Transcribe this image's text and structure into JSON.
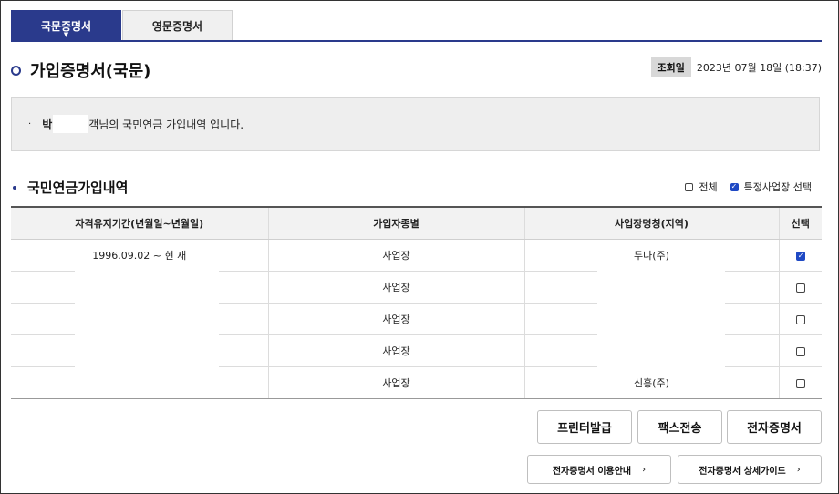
{
  "tabs": [
    {
      "label": "국문증명서",
      "active": true
    },
    {
      "label": "영문증명서",
      "active": false
    }
  ],
  "page_title": "가입증명서(국문)",
  "date": {
    "badge": "조회일",
    "value": "2023년 07월 18일 (18:37)"
  },
  "info": {
    "bullet": "·",
    "name_initial": "박",
    "text": "객님의 국민연금 가입내역 입니다."
  },
  "section_title": "국민연금가입내역",
  "filters": {
    "all_label": "전체",
    "all_checked": false,
    "specific_label": "특정사업장 선택",
    "specific_checked": true
  },
  "table": {
    "headers": [
      "자격유지기간(년월일~년월일)",
      "가입자종별",
      "사업장명칭(지역)",
      "선택"
    ],
    "rows": [
      {
        "period": "1996.09.02 ~ 현 재",
        "type": "사업장",
        "workplace": "두나(주)",
        "selected": true
      },
      {
        "period": "",
        "type": "사업장",
        "workplace": "",
        "selected": false
      },
      {
        "period": "",
        "type": "사업장",
        "workplace": "",
        "selected": false
      },
      {
        "period": "",
        "type": "사업장",
        "workplace": "",
        "selected": false
      },
      {
        "period": "",
        "type": "사업장",
        "workplace": "신흥(주)",
        "selected": false
      }
    ]
  },
  "buttons": {
    "print": "프린터발급",
    "fax": "팩스전송",
    "electronic": "전자증명서",
    "guide_usage": "전자증명서 이용안내",
    "guide_detail": "전자증명서 상세가이드",
    "chevron": "›"
  },
  "colors": {
    "accent": "#2a3a8c",
    "check": "#1f49c4"
  }
}
